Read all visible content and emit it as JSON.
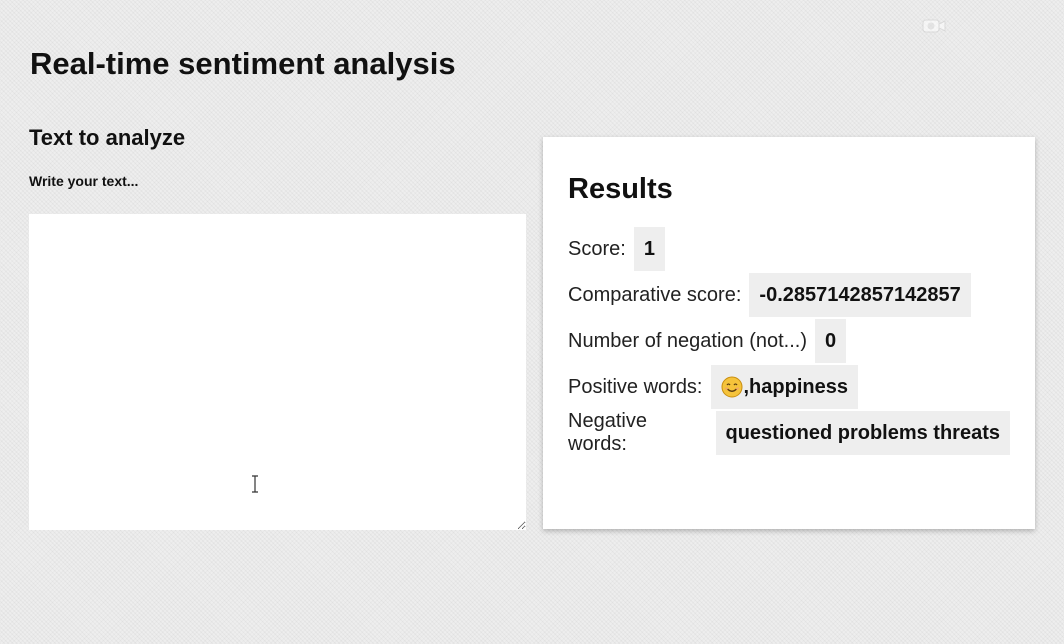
{
  "page": {
    "title": "Real-time sentiment analysis"
  },
  "input_section": {
    "title": "Text to analyze",
    "label": "Write your text...",
    "value": ""
  },
  "results": {
    "title": "Results",
    "rows": [
      {
        "label": "Score:",
        "value": "1"
      },
      {
        "label": "Comparative score:",
        "value": "-0.2857142857142857"
      },
      {
        "label": "Number of negation (not...)",
        "value": "0"
      },
      {
        "label": "Positive words:",
        "value": ",happiness",
        "icon": "smiling-face-emoji"
      },
      {
        "label": "Negative words:",
        "value": "questioned problems threats"
      }
    ]
  },
  "colors": {
    "background": "#eeeeee",
    "card": "#ffffff",
    "value_chip": "#eeeeee",
    "emoji": "#f5c33b"
  },
  "watermark": {
    "icon": "camera-icon"
  }
}
